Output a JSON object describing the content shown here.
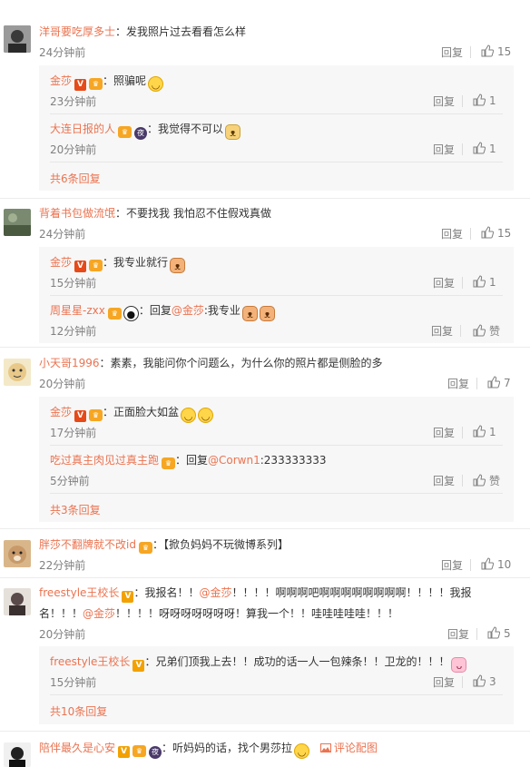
{
  "comments": [
    {
      "user": "洋哥要吃厚多士",
      "text": "：发我照片过去看看怎么样",
      "time": "24分钟前",
      "reply": "回复",
      "likes": "15",
      "avatar_color": "#6b6b6b",
      "replies": [
        {
          "user": "金莎",
          "badges": [
            "v",
            "crown"
          ],
          "text": "：照骗呢",
          "emoji": "smile",
          "time": "23分钟前",
          "reply": "回复",
          "likes": "1"
        },
        {
          "user": "大连日报的人",
          "badges": [
            "crown",
            "night"
          ],
          "text": "：我觉得不可以",
          "emoji": "dog",
          "time": "20分钟前",
          "reply": "回复",
          "likes": "1"
        }
      ],
      "more": "共6条回复"
    },
    {
      "user": "背着书包做流氓",
      "text": "：不要找我 我怕忍不住假戏真做",
      "time": "24分钟前",
      "reply": "回复",
      "likes": "15",
      "avatar_color": "#5d6b58",
      "replies": [
        {
          "user": "金莎",
          "badges": [
            "v",
            "crown"
          ],
          "text": "：我专业就行",
          "emoji": "cat",
          "time": "15分钟前",
          "reply": "回复",
          "likes": "1"
        },
        {
          "user": "周星星-zxx",
          "badges": [
            "crown",
            "panda"
          ],
          "text_pre": "：回复",
          "mention": "@金莎",
          "text": ":我专业",
          "emoji": "cat2",
          "time": "12分钟前",
          "reply": "回复",
          "likes": "赞"
        }
      ],
      "more": ""
    },
    {
      "user": "小天哥1996",
      "text": "：素素，我能问你个问题么，为什么你的照片都是侧脸的多",
      "time": "20分钟前",
      "reply": "回复",
      "likes": "7",
      "avatar_color": "#e8d6a8",
      "replies": [
        {
          "user": "金莎",
          "badges": [
            "v",
            "crown"
          ],
          "text": "：正面脸大如盆",
          "emoji": "smile2",
          "time": "17分钟前",
          "reply": "回复",
          "likes": "1"
        },
        {
          "user": "吃过真主肉见过真主跑",
          "badges": [
            "crown"
          ],
          "text_pre": "：回复",
          "mention": "@Corwn1",
          "text": ":233333333",
          "emoji": "",
          "time": "5分钟前",
          "reply": "回复",
          "likes": "赞"
        }
      ],
      "more": "共3条回复"
    },
    {
      "user": "胖莎不翻牌就不改id",
      "text": "：【掀负妈妈不玩微博系列】",
      "time": "22分钟前",
      "reply": "回复",
      "likes": "10",
      "avatar_color": "#c89a6a",
      "replies": [],
      "more": ""
    },
    {
      "user": "freestyle王校长",
      "text_line1_pre": "：我报名！！",
      "mention1": "@金莎",
      "text_line1_post": "！！！！啊啊啊吧啊啊啊啊啊啊啊啊！！！！我报",
      "text_line2_pre": "名！！！",
      "mention2": "@金莎",
      "text_line2_post": "！！！！呀呀呀呀呀呀呀！算我一个！！哇哇哇哇哇！！！",
      "time": "20分钟前",
      "reply": "回复",
      "likes": "5",
      "avatar_color": "#7a6a6a",
      "replies": [
        {
          "user": "freestyle王校长",
          "badges": [
            "vy"
          ],
          "text": "：兄弟们顶我上去！！成功的话一人一包辣条！！卫龙的！！！",
          "emoji": "rabbit",
          "time": "15分钟前",
          "reply": "回复",
          "likes": "3"
        }
      ],
      "more": "共10条回复"
    },
    {
      "user": "陪伴最久是心安",
      "text": "：听妈妈的话，找个男莎拉",
      "time": "",
      "reply": "",
      "likes": "",
      "avatar_color": "#3a3a3a",
      "pic_comment": "评论配图",
      "replies": [],
      "more": ""
    }
  ],
  "badge_labels": {
    "v": "V",
    "vy": "V",
    "crown": "♛",
    "night": "夜"
  },
  "icons": {
    "thumb": "thumb-up-icon",
    "image": "image-icon"
  }
}
